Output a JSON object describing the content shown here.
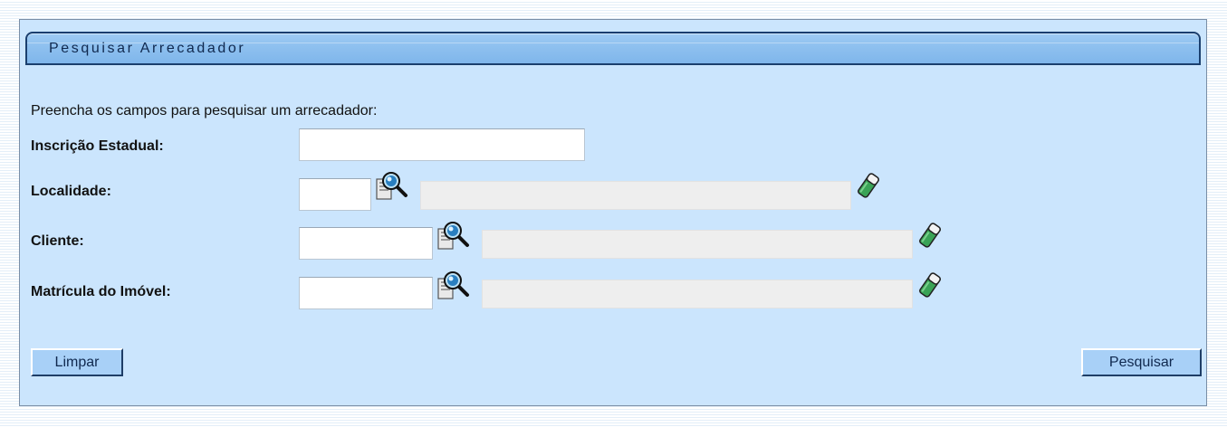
{
  "panel": {
    "title": "Pesquisar Arrecadador",
    "instructions": "Preencha os campos para pesquisar um arrecadador:"
  },
  "form": {
    "inscricao": {
      "label": "Inscrição Estadual:",
      "value": ""
    },
    "localidade": {
      "label": "Localidade:",
      "value": "",
      "description": "",
      "search_icon": "magnifier-search-icon",
      "clear_icon": "eraser-icon"
    },
    "cliente": {
      "label": "Cliente:",
      "value": "",
      "description": "",
      "search_icon": "magnifier-search-icon",
      "clear_icon": "eraser-icon"
    },
    "matricula": {
      "label": "Matrícula do Imóvel:",
      "value": "",
      "description": "",
      "search_icon": "magnifier-search-icon",
      "clear_icon": "eraser-icon"
    }
  },
  "buttons": {
    "clear_label": "Limpar",
    "search_label": "Pesquisar"
  },
  "colors": {
    "panel_bg": "#cbe5fd",
    "title_bar": "#8ec0ef",
    "button_bg": "#a8d0f7",
    "readonly_bg": "#eeeeee"
  }
}
